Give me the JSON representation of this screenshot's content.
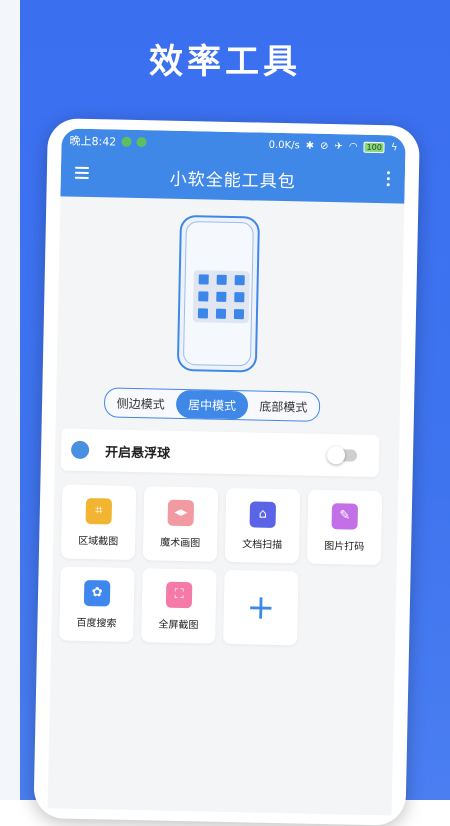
{
  "banner": {
    "title": "效率工具"
  },
  "status_bar": {
    "time": "晚上8:42",
    "network_speed": "0.0K/s",
    "battery": "100"
  },
  "app_bar": {
    "title": "小软全能工具包"
  },
  "mode_selector": {
    "options": [
      "侧边模式",
      "居中模式",
      "底部模式"
    ],
    "selected": "居中模式"
  },
  "floating_ball": {
    "label": "开启悬浮球",
    "enabled": false
  },
  "tools": [
    {
      "label": "区域截图",
      "icon": "crop-icon",
      "color": "#f2b531"
    },
    {
      "label": "魔术画图",
      "icon": "magic-draw-icon",
      "color": "#f19aa2"
    },
    {
      "label": "文档扫描",
      "icon": "document-scan-icon",
      "color": "#5b63e6"
    },
    {
      "label": "图片打码",
      "icon": "image-mosaic-icon",
      "color": "#c36fe8"
    },
    {
      "label": "百度搜索",
      "icon": "baidu-paw-icon",
      "color": "#3f87ee"
    },
    {
      "label": "全屏截图",
      "icon": "fullscreen-capture-icon",
      "color": "#f57aa8"
    }
  ],
  "add_tool": {
    "icon": "plus-icon"
  },
  "colors": {
    "accent": "#4088e8",
    "background_blue": "#3a6ff0"
  }
}
